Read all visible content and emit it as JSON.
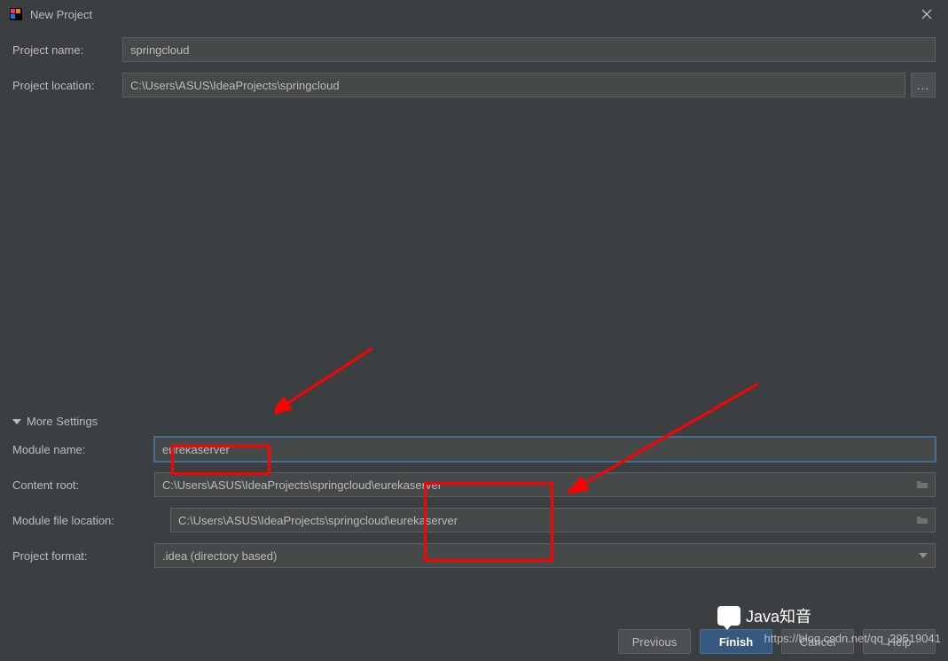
{
  "window": {
    "title": "New Project"
  },
  "form": {
    "project_name_label": "Project name:",
    "project_name_value": "springcloud",
    "project_location_label": "Project location:",
    "project_location_value": "C:\\Users\\ASUS\\IdeaProjects\\springcloud",
    "browse_label": "..."
  },
  "more_settings": {
    "header": "More Settings",
    "module_name_label": "Module name:",
    "module_name_value": "eurekaserver",
    "content_root_label": "Content root:",
    "content_root_value": "C:\\Users\\ASUS\\IdeaProjects\\springcloud\\eurekaserver",
    "module_file_loc_label": "Module file location:",
    "module_file_loc_value": "C:\\Users\\ASUS\\IdeaProjects\\springcloud\\eurekaserver",
    "project_format_label": "Project format:",
    "project_format_value": ".idea (directory based)"
  },
  "footer": {
    "previous": "Previous",
    "finish": "Finish",
    "cancel": "Cancel",
    "help": "Help"
  },
  "watermark": {
    "logo_text": "Java知音",
    "url": "https://blog.csdn.net/qq_29519041"
  }
}
